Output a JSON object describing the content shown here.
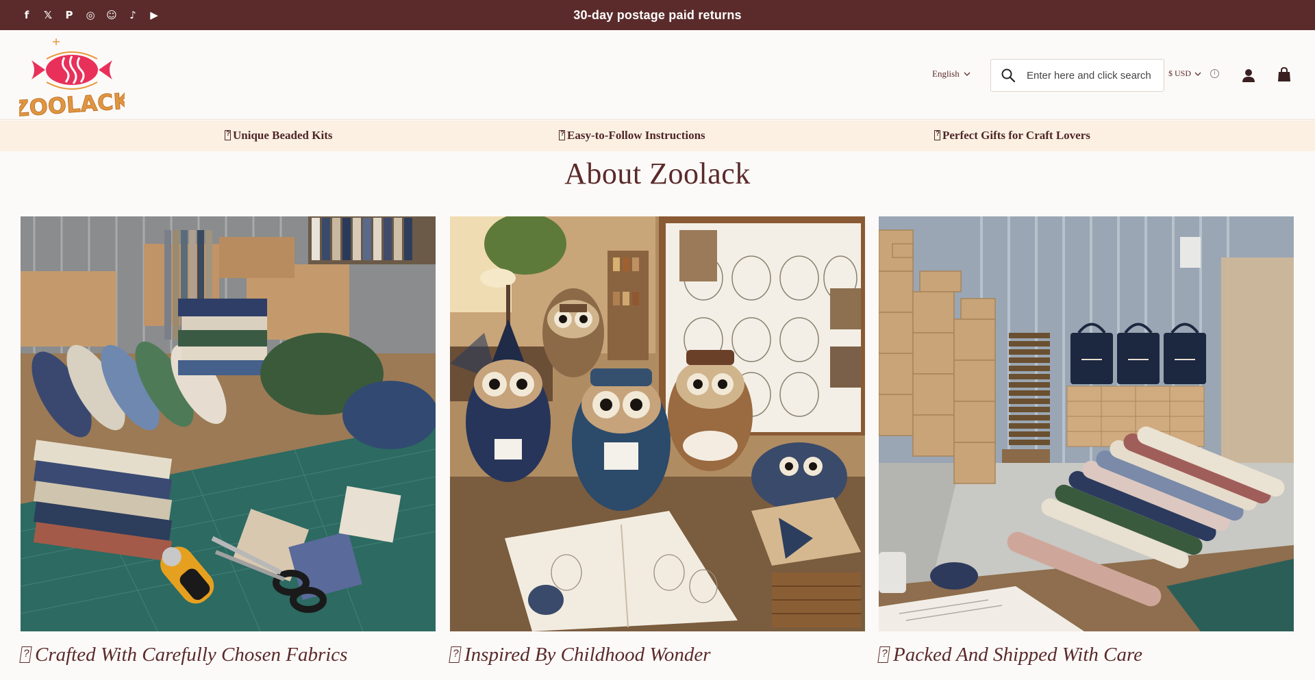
{
  "announcement": {
    "text": "30-day postage paid returns"
  },
  "social": {
    "items": [
      {
        "name": "facebook-icon",
        "glyph": "f"
      },
      {
        "name": "x-icon",
        "glyph": "𝕏"
      },
      {
        "name": "pinterest-icon",
        "glyph": "P"
      },
      {
        "name": "instagram-icon",
        "glyph": "◎"
      },
      {
        "name": "snapchat-icon",
        "glyph": "☺"
      },
      {
        "name": "tiktok-icon",
        "glyph": "♪"
      },
      {
        "name": "youtube-icon",
        "glyph": "▶"
      }
    ]
  },
  "header": {
    "logo_text": "ZOOLACK",
    "language": "English",
    "search_placeholder": "Enter here and click search",
    "currency": "$ USD",
    "info_glyph": "i"
  },
  "benefits": [
    {
      "label": "Unique Beaded Kits"
    },
    {
      "label": "Easy-to-Follow Instructions"
    },
    {
      "label": "Perfect Gifts for Craft Lovers"
    }
  ],
  "about": {
    "title": "About Zoolack",
    "cards": [
      {
        "caption": "Crafted With Carefully Chosen Fabrics",
        "image": "fabric-workshop-photo"
      },
      {
        "caption": "Inspired By Childhood Wonder",
        "image": "owl-craft-studio-photo"
      },
      {
        "caption": "Packed And Shipped With Care",
        "image": "warehouse-packing-photo"
      }
    ]
  },
  "colors": {
    "topbar": "#5b2b2b",
    "text": "#5a2a2a",
    "benefits_bg": "#fbf0e2",
    "page_bg": "#fcfaf8"
  }
}
